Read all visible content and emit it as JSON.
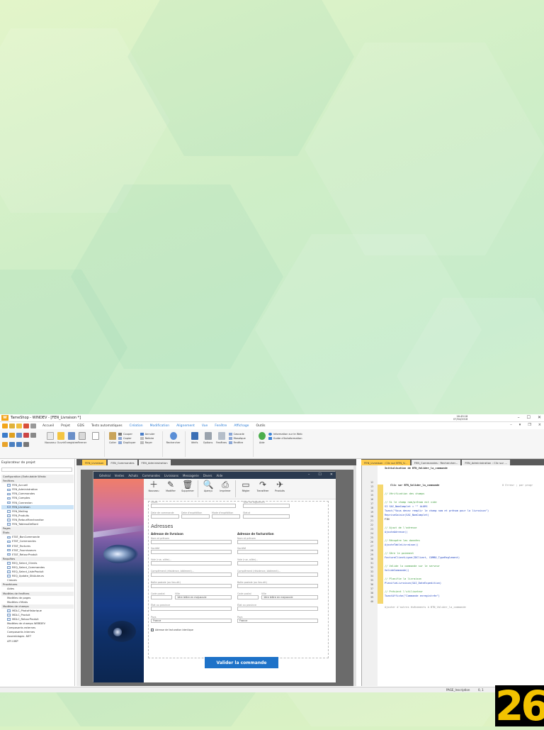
{
  "window": {
    "title": "TameShop - WINDEV - [FEN_Livraison *]",
    "clock_line1": "16:49:18",
    "clock_line2": "07/04/2018",
    "controls": [
      "–",
      "☐",
      "✕"
    ]
  },
  "menus": [
    "Accueil",
    "Projet",
    "GDS",
    "Tests automatiques",
    "Création",
    "Modification",
    "Alignement",
    "Vue",
    "Fenêtre",
    "Affichage",
    "Outils"
  ],
  "menus_blue": [
    "Création",
    "Modification",
    "Alignement",
    "Vue",
    "Fenêtre",
    "Affichage"
  ],
  "ribbon": {
    "large": [
      "Nouveau",
      "Ouvrir",
      "Enregistrer",
      "Fermer",
      "Coller",
      "Rechercher",
      "Vérifs",
      "Options",
      "Fenêtres",
      "Aide"
    ],
    "edit_small": [
      "Couper",
      "Copier",
      "Dupliquer"
    ],
    "undo_small": [
      "Annuler",
      "Refaire",
      "Rayer"
    ],
    "win_small": [
      "Cascade",
      "Mosaïque",
      "Fenêtre"
    ],
    "help_small": [
      "Information sur le Web",
      "Guide d'Autoformation"
    ]
  },
  "doc_tabs": [
    "FEN_Livraison",
    "FEN_Commandes",
    "FEN_Administration"
  ],
  "code_tabs": [
    "FEN_Livraison : Clic sur BTN_V...",
    "FEN_Commandes : Rechercher...",
    "FEN_Administration : Clic sur ..."
  ],
  "explorer": {
    "title": "Explorateur de projet",
    "items": [
      {
        "label": "Configuration (Exécutable Windo",
        "kind": "sec"
      },
      {
        "label": "Fenêtres",
        "kind": "sec"
      },
      {
        "label": "FEN_Accueil",
        "kind": "file"
      },
      {
        "label": "FEN_Administration",
        "kind": "file"
      },
      {
        "label": "FEN_Commandes",
        "kind": "file"
      },
      {
        "label": "FEN_Comptes",
        "kind": "file"
      },
      {
        "label": "FEN_Connexion",
        "kind": "file"
      },
      {
        "label": "FEN_Livraison",
        "kind": "sel"
      },
      {
        "label": "FEN_Mailing",
        "kind": "file"
      },
      {
        "label": "FEN_Produits",
        "kind": "file"
      },
      {
        "label": "FEN_RetourMarchandise",
        "kind": "file"
      },
      {
        "label": "FEN_TableauDeBord",
        "kind": "file"
      },
      {
        "label": "Pages",
        "kind": "sec"
      },
      {
        "label": "États",
        "kind": "sec"
      },
      {
        "label": "ETAT_BonCommande",
        "kind": "file"
      },
      {
        "label": "ETAT_Commandes",
        "kind": "file"
      },
      {
        "label": "ETAT_Factures",
        "kind": "file"
      },
      {
        "label": "ETAT_Fournisseurs",
        "kind": "file"
      },
      {
        "label": "ETAT_RetourProduit",
        "kind": "file"
      },
      {
        "label": "Requêtes",
        "kind": "sec"
      },
      {
        "label": "REQ_Select_Clients",
        "kind": "file"
      },
      {
        "label": "REQ_Select_Commandes",
        "kind": "file"
      },
      {
        "label": "REQ_Select_ListeProduit",
        "kind": "file"
      },
      {
        "label": "REQ_Update_StkAuteurs",
        "kind": "file"
      },
      {
        "label": "Classes",
        "kind": "plain"
      },
      {
        "label": "Procédures",
        "kind": "sec"
      },
      {
        "label": "Aides",
        "kind": "plain"
      },
      {
        "label": "Modèles de fenêtres",
        "kind": "sec"
      },
      {
        "label": "Modèles de pages",
        "kind": "plain"
      },
      {
        "label": "Modèles d'états",
        "kind": "plain"
      },
      {
        "label": "Modèles de champs",
        "kind": "sec"
      },
      {
        "label": "MDLC_PhotoHistorique",
        "kind": "file"
      },
      {
        "label": "MDLC_Produit",
        "kind": "file"
      },
      {
        "label": "MDLC_RetourProduit",
        "kind": "file"
      },
      {
        "label": "Modèles de champs WEBDEV",
        "kind": "plain"
      },
      {
        "label": "Composants externes",
        "kind": "plain"
      },
      {
        "label": "Composants internes",
        "kind": "plain"
      },
      {
        "label": "Assemblages .NET",
        "kind": "plain"
      },
      {
        "label": "API UWP",
        "kind": "plain"
      }
    ]
  },
  "form": {
    "menus": [
      "Général",
      "Ventes",
      "Achats",
      "Commandes",
      "Livraisons",
      "Messagerie",
      "Divers",
      "Aide"
    ],
    "tools": [
      {
        "icon": "＋",
        "label": "Nouveau"
      },
      {
        "icon": "✎",
        "label": "Modifier"
      },
      {
        "icon": "🗑",
        "label": "Supprimer"
      },
      {
        "icon": "🔍",
        "label": "Aperçu"
      },
      {
        "icon": "⎙",
        "label": "Imprimer"
      },
      {
        "icon": "▭",
        "label": "Régler"
      },
      {
        "icon": "↷",
        "label": "Transférer"
      },
      {
        "icon": "✈",
        "label": "Produits"
      }
    ],
    "labels": {
      "client": "Client",
      "type_reglement": "Type de règlement",
      "date_commande": "Date de commande",
      "date_expedition": "Date d'expédition",
      "mode_expedition": "Mode d'expédition",
      "statut": "Statut",
      "adresses": "Adresses",
      "livraison": "Adresse de livraison",
      "facturation": "Adresse de facturation",
      "nom": "Nom et prénom",
      "societe": "Société",
      "voie": "Voie (rue, allée)...",
      "complement": "Complément (résidence, bâtiment)...",
      "boite": "Boîte postale (ou lieu-dit)",
      "cp": "Code postal",
      "ville": "Ville",
      "ville_value": "1ère lettre en majuscule",
      "etat": "État ou province",
      "pays": "Pays",
      "pays_value": "France",
      "checkbox": "Adresse de facturation identique",
      "button": "Valider la commande"
    }
  },
  "code": {
    "header": "Initialisation de BTN_Valider_la_commande",
    "event": "Clic sur BTN_Valider_la_commande",
    "status_hint": "0 Erreur ; par progr",
    "lines": [
      {
        "n": "12",
        "t": "",
        "c": "tx"
      },
      {
        "n": "",
        "t": "// Vérification des champs",
        "c": "cm"
      },
      {
        "n": "",
        "t": "",
        "c": "tx"
      },
      {
        "n": "",
        "t": "// Si le champ nom/prénom est vide",
        "c": "cm"
      },
      {
        "n": "",
        "t": "SI SAI_NomComplet = \"\" ALORS",
        "c": "kw"
      },
      {
        "n": "",
        "t": "   Toast(\"Vous devez remplir le champ nom et prénom pour la livraison\")",
        "c": "kw"
      },
      {
        "n": "",
        "t": "   RepriseSaisie(SAI_NomComplet)",
        "c": "kw"
      },
      {
        "n": "",
        "t": "FIN",
        "c": "tx"
      },
      {
        "n": "",
        "t": "",
        "c": "tx"
      },
      {
        "n": "",
        "t": "// Ajout de l'adresse",
        "c": "cm"
      },
      {
        "n": "",
        "t": "AjouteAdresse()",
        "c": "kw"
      },
      {
        "n": "",
        "t": "",
        "c": "tx"
      },
      {
        "n": "",
        "t": "// Récupère les données",
        "c": "cm"
      },
      {
        "n": "",
        "t": "AjouteTableLivraison()",
        "c": "kw"
      },
      {
        "n": "",
        "t": "",
        "c": "tx"
      },
      {
        "n": "",
        "t": "// Gère le paiement",
        "c": "cm"
      },
      {
        "n": "",
        "t": "FactureClientLigne(IDClient, COMBO_TypeReglement)",
        "c": "kw"
      },
      {
        "n": "",
        "t": "",
        "c": "tx"
      },
      {
        "n": "",
        "t": "// Valide la commande sur le serveur",
        "c": "cm"
      },
      {
        "n": "",
        "t": "ValideCommande()",
        "c": "kw"
      },
      {
        "n": "",
        "t": "",
        "c": "tx"
      },
      {
        "n": "",
        "t": "// Planifie la livraison",
        "c": "cm"
      },
      {
        "n": "",
        "t": "PlanifieLivraison(SAI_DateExpedition)",
        "c": "kw"
      },
      {
        "n": "",
        "t": "",
        "c": "tx"
      },
      {
        "n": "",
        "t": "// Prévient l'utilisateur",
        "c": "cm"
      },
      {
        "n": "",
        "t": "ToastAffiche(\"Commande enregistrée\")",
        "c": "kw"
      }
    ],
    "footer": "Ajouter d'autres événements à BTN_Valider_la_commande",
    "line_numbers": [
      "12",
      "13",
      "14",
      "15",
      "16",
      "17",
      "18",
      "19",
      "20",
      "21",
      "22",
      "23",
      "24",
      "25",
      "26",
      "27",
      "28",
      "29",
      "30",
      "31",
      "32",
      "33",
      "34",
      "35",
      "36",
      "37",
      "38",
      "39",
      "40"
    ]
  },
  "statusbar": {
    "item1": "PAGE_Inscription",
    "item2": "0, 1"
  },
  "page_number": "26",
  "colors": {
    "accent": "#2a7bd6",
    "tab_active": "#ffcc4d",
    "button": "#1e72c8",
    "page_number": "#f2c200"
  }
}
